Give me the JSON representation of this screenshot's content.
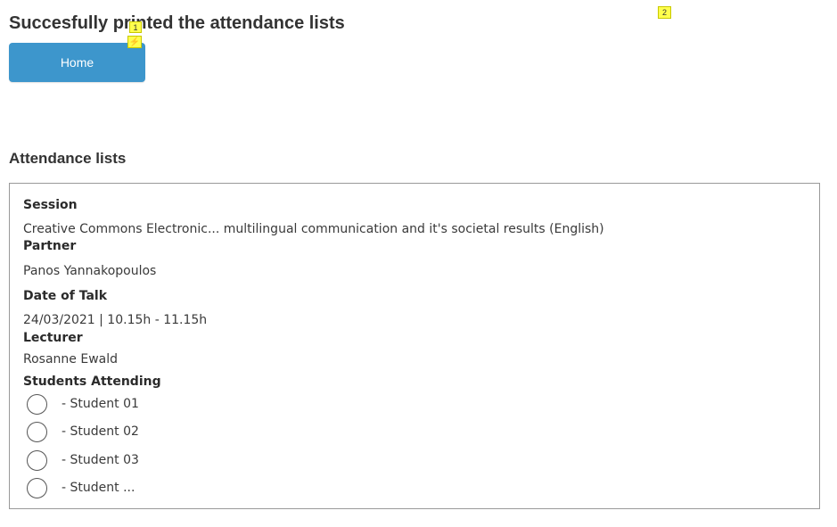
{
  "header": {
    "title": "Succesfully printed the attendance lists",
    "home_button_label": "Home"
  },
  "markers": {
    "first": "1",
    "bolt": "⚡",
    "second": "2"
  },
  "attendance": {
    "title": "Attendance lists",
    "session_label": "Session",
    "session_value": "Creative Commons Electronic... multilingual communication and it's societal results (English)",
    "partner_label": "Partner",
    "partner_value": "Panos Yannakopoulos",
    "date_label": "Date of Talk",
    "date_value": "24/03/2021 | 10.15h - 11.15h",
    "lecturer_label": "Lecturer",
    "lecturer_value": "Rosanne Ewald",
    "students_label": "Students Attending",
    "students": [
      "- Student 01",
      "- Student 02",
      "- Student 03",
      "- Student ..."
    ]
  },
  "colors": {
    "primary_button": "#3d96cc",
    "card_border": "#999999",
    "marker_yellow": "#ffff4d"
  }
}
